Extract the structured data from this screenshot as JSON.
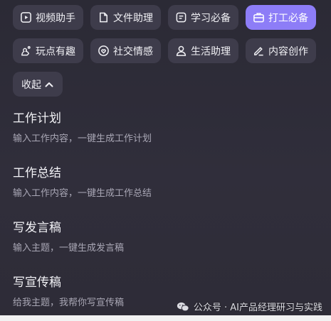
{
  "chips_row1": [
    {
      "label": "视频助手",
      "icon": "play-square-icon"
    },
    {
      "label": "文件助理",
      "icon": "file-icon"
    },
    {
      "label": "学习必备",
      "icon": "note-icon"
    },
    {
      "label": "打工必备",
      "icon": "briefcase-icon",
      "active": true
    }
  ],
  "chips_row2": [
    {
      "label": "玩点有趣",
      "icon": "puzzle-icon"
    },
    {
      "label": "社交情感",
      "icon": "heart-icon"
    },
    {
      "label": "生活助理",
      "icon": "person-icon"
    },
    {
      "label": "内容创作",
      "icon": "pen-icon"
    }
  ],
  "collapse_label": "收起",
  "items": [
    {
      "title": "工作计划",
      "desc": "输入工作内容，一键生成工作计划"
    },
    {
      "title": "工作总结",
      "desc": "输入工作内容，一键生成工作总结"
    },
    {
      "title": "写发言稿",
      "desc": "输入主题，一键生成发言稿"
    },
    {
      "title": "写宣传稿",
      "desc": "给我主题，我帮你写宣传稿"
    }
  ],
  "watermark": "公众号 · AI产品经理研习与实践",
  "colors": {
    "accent": "#8d7df7",
    "chip_bg": "#3e3c4b",
    "page_bg": "#2f2d3a"
  }
}
